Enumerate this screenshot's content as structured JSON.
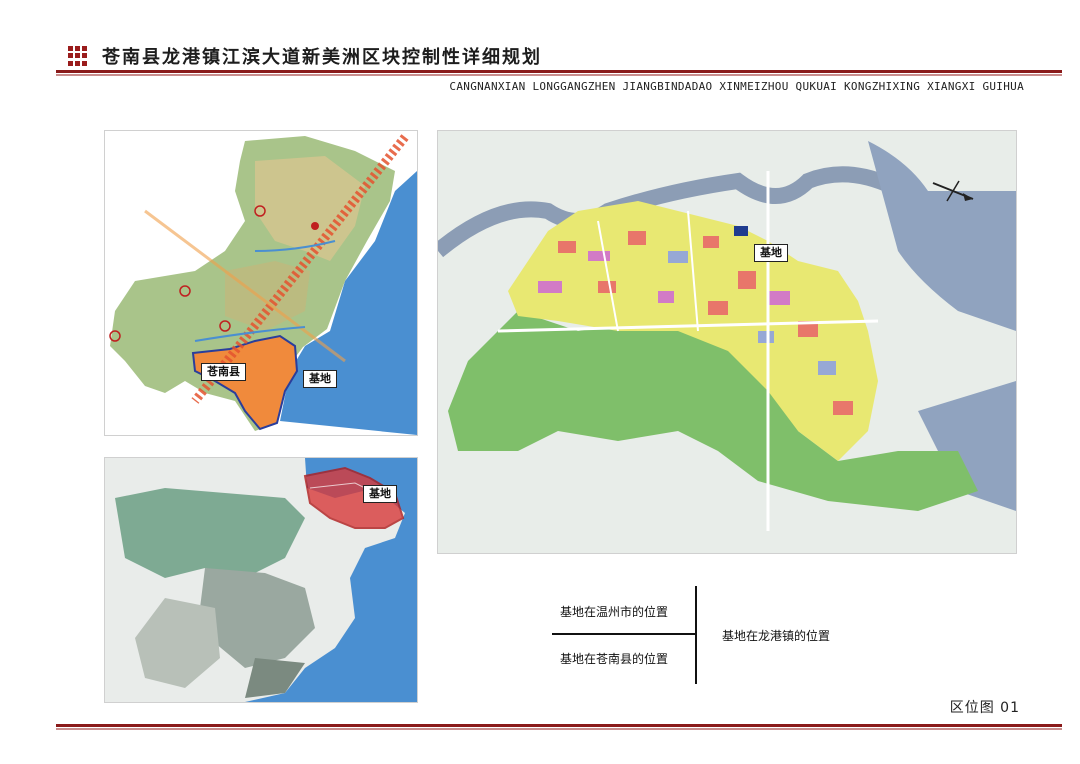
{
  "header": {
    "title": "苍南县龙港镇江滨大道新美洲区块控制性详细规划",
    "pinyin": "CANGNANXIAN LONGGANGZHEN JIANGBINDADAO XINMEIZHOU QUKUAI KONGZHIXING XIANGXI GUIHUA"
  },
  "maps": {
    "wenzhou": {
      "county_label": "苍南县",
      "site_label": "基地"
    },
    "cangnan": {
      "site_label": "基地"
    },
    "longgang": {
      "site_label": "基地"
    }
  },
  "legend": {
    "wenzhou_caption": "基地在温州市的位置",
    "cangnan_caption": "基地在苍南县的位置",
    "longgang_caption": "基地在龙港镇的位置"
  },
  "footer": {
    "figure_label": "区位图  01"
  },
  "colors": {
    "accent": "#8a1a1a",
    "sea": "#4a8fd1",
    "county_highlight": "#f08a3c",
    "site_highlight": "#d83a3a"
  }
}
